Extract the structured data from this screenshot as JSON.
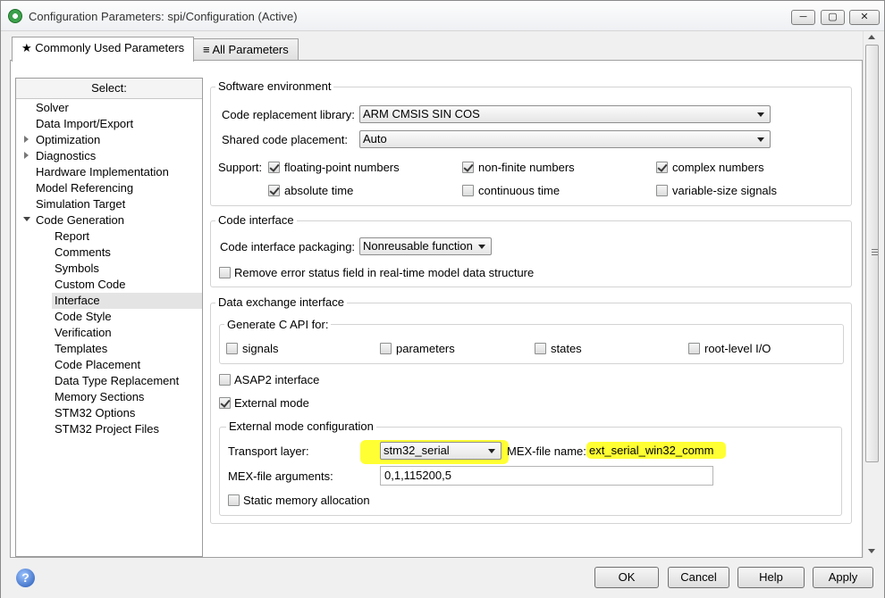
{
  "window": {
    "title": "Configuration Parameters: spi/Configuration (Active)",
    "controls": {
      "minimize": "─",
      "maximize": "▢",
      "close": "✕"
    }
  },
  "tabs": [
    {
      "label": "Commonly Used Parameters",
      "icon": "★",
      "active": true
    },
    {
      "label": "All Parameters",
      "icon": "≡",
      "active": false
    }
  ],
  "sidebar": {
    "header": "Select:",
    "items": [
      {
        "label": "Solver"
      },
      {
        "label": "Data Import/Export"
      },
      {
        "label": "Optimization"
      },
      {
        "label": "Diagnostics"
      },
      {
        "label": "Hardware Implementation"
      },
      {
        "label": "Model Referencing"
      },
      {
        "label": "Simulation Target"
      },
      {
        "label": "Code Generation"
      },
      {
        "label": "Report"
      },
      {
        "label": "Comments"
      },
      {
        "label": "Symbols"
      },
      {
        "label": "Custom Code"
      },
      {
        "label": "Interface"
      },
      {
        "label": "Code Style"
      },
      {
        "label": "Verification"
      },
      {
        "label": "Templates"
      },
      {
        "label": "Code Placement"
      },
      {
        "label": "Data Type Replacement"
      },
      {
        "label": "Memory Sections"
      },
      {
        "label": "STM32 Options"
      },
      {
        "label": "STM32 Project Files"
      }
    ]
  },
  "software_environment": {
    "title": "Software environment",
    "code_replacement_library_label": "Code replacement library:",
    "code_replacement_library_value": "ARM CMSIS SIN COS",
    "shared_code_placement_label": "Shared code placement:",
    "shared_code_placement_value": "Auto",
    "support_label": "Support:",
    "support": [
      {
        "label": "floating-point numbers",
        "checked": true
      },
      {
        "label": "non-finite numbers",
        "checked": true
      },
      {
        "label": "complex numbers",
        "checked": true
      },
      {
        "label": "absolute time",
        "checked": true
      },
      {
        "label": "continuous time",
        "checked": false
      },
      {
        "label": "variable-size signals",
        "checked": false
      }
    ]
  },
  "code_interface": {
    "title": "Code interface",
    "packaging_label": "Code interface packaging:",
    "packaging_value": "Nonreusable function",
    "remove_error_status_label": "Remove error status field in real-time model data structure",
    "remove_error_status_checked": false
  },
  "data_exchange": {
    "title": "Data exchange interface",
    "c_api_title": "Generate C API for:",
    "c_api": [
      {
        "label": "signals",
        "checked": false
      },
      {
        "label": "parameters",
        "checked": false
      },
      {
        "label": "states",
        "checked": false
      },
      {
        "label": "root-level I/O",
        "checked": false
      }
    ],
    "asap2_label": "ASAP2 interface",
    "asap2_checked": false,
    "external_mode_label": "External mode",
    "external_mode_checked": true,
    "ext_config": {
      "title": "External mode configuration",
      "transport_layer_label": "Transport layer:",
      "transport_layer_value": "stm32_serial",
      "mex_file_name_label": "MEX-file name:",
      "mex_file_name_value": "ext_serial_win32_comm",
      "mex_file_args_label": "MEX-file arguments:",
      "mex_file_args_value": "0,1,115200,5",
      "static_memory_label": "Static memory allocation",
      "static_memory_checked": false
    }
  },
  "footer": {
    "help_icon": "?",
    "buttons": {
      "ok": "OK",
      "cancel": "Cancel",
      "help": "Help",
      "apply": "Apply"
    }
  },
  "colors": {
    "highlight": "#ffff33",
    "selected_row": "#e4e4e4"
  }
}
